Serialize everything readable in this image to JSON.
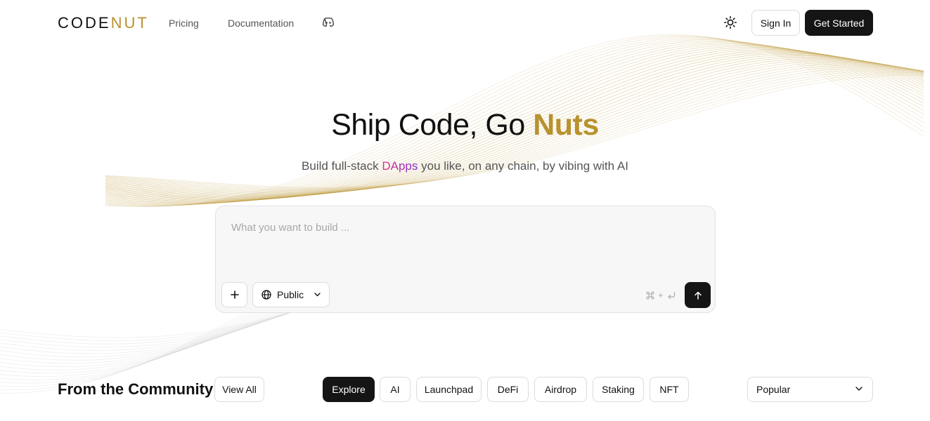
{
  "nav": {
    "logo_code": "CODE",
    "logo_nut": "NUT",
    "pricing": "Pricing",
    "documentation": "Documentation",
    "discord_icon": "discord-icon",
    "theme_icon": "sun-icon",
    "sign_in": "Sign In",
    "get_started": "Get Started"
  },
  "hero": {
    "title_main": "Ship Code, Go ",
    "title_accent": "Nuts",
    "subtitle_before": "Build full-stack ",
    "subtitle_highlight": "DApps",
    "subtitle_after": " you like, on any chain, by vibing with AI"
  },
  "prompt": {
    "placeholder": "What you want to build ...",
    "attach_icon": "plus-icon",
    "visibility_icon": "globe-icon",
    "visibility_value": "Public",
    "shortcut_plus": "+",
    "send_icon": "arrow-up-icon"
  },
  "community": {
    "title": "From the Community",
    "view_all": "View All",
    "categories": [
      "Explore",
      "AI",
      "Launchpad",
      "DeFi",
      "Airdrop",
      "Staking",
      "NFT"
    ],
    "active_category": "Explore",
    "sort_value": "Popular"
  },
  "colors": {
    "accent_gold": "#b8922e",
    "dark_button": "#151515",
    "dapps_gradient_start": "#e8308a",
    "dapps_gradient_end": "#7b2fd0"
  }
}
